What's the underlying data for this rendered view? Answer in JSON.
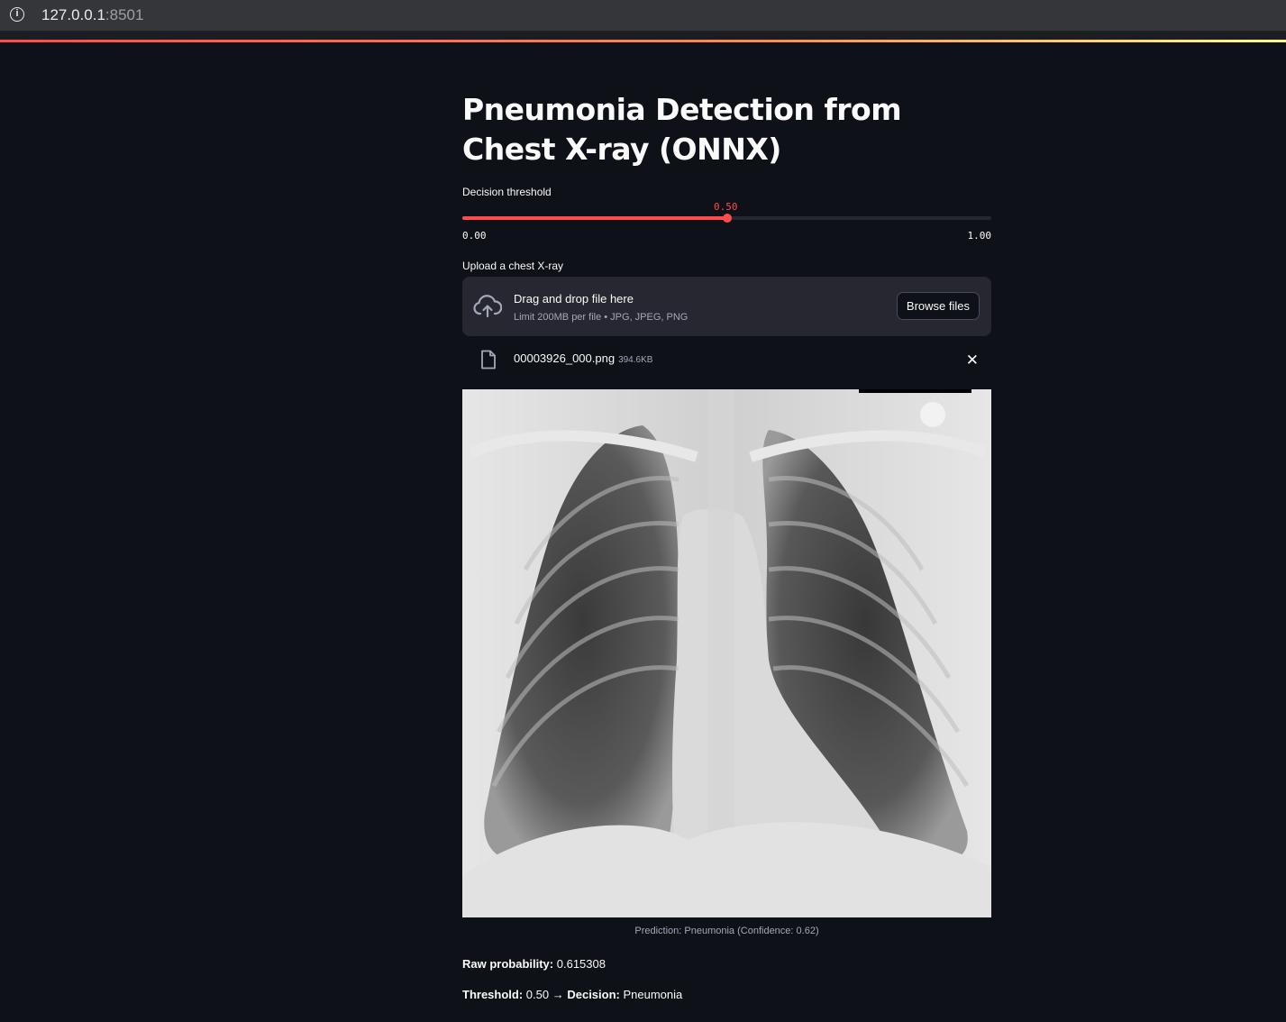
{
  "browser": {
    "url_host": "127.0.0.1",
    "url_port": ":8501"
  },
  "page": {
    "title": "Pneumonia Detection from Chest X-ray (ONNX)"
  },
  "slider": {
    "label": "Decision threshold",
    "value": 0.5,
    "value_text": "0.50",
    "min_text": "0.00",
    "max_text": "1.00",
    "accent": "#ff4b4b"
  },
  "uploader": {
    "label": "Upload a chest X-ray",
    "drop_text": "Drag and drop file here",
    "limit_text": "Limit 200MB per file • JPG, JPEG, PNG",
    "browse_label": "Browse files",
    "icon": "cloud-upload-icon"
  },
  "file": {
    "name": "00003926_000.png",
    "size": "394.6KB",
    "icon": "file-icon",
    "close_icon": "close-icon"
  },
  "image": {
    "caption": "Prediction: Pneumonia (Confidence: 0.62)"
  },
  "results": {
    "raw_label": "Raw probability:",
    "raw_value": "0.615308",
    "threshold_label": "Threshold:",
    "threshold_value": "0.50 →",
    "decision_label": "Decision:",
    "decision_value": "Pneumonia"
  }
}
